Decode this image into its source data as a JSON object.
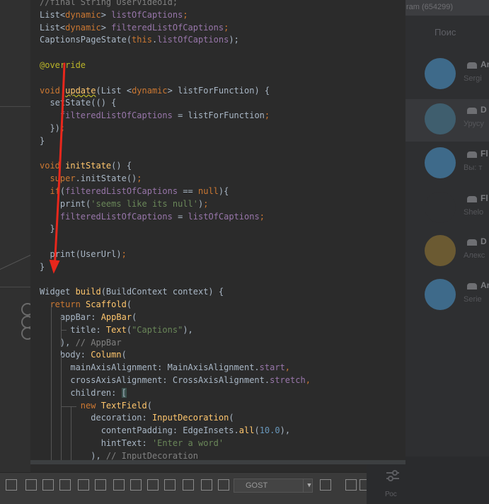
{
  "editor": {
    "lines": [
      [
        {
          "t": "//final String UserVideoId;",
          "c": "cm"
        }
      ],
      [
        {
          "t": "List<",
          "c": ""
        },
        {
          "t": "dynamic",
          "c": "kw"
        },
        {
          "t": "> ",
          "c": ""
        },
        {
          "t": "listOfCaptions",
          "c": "fld"
        },
        {
          "t": ";",
          "c": "kw"
        }
      ],
      [
        {
          "t": "List<",
          "c": ""
        },
        {
          "t": "dynamic",
          "c": "kw"
        },
        {
          "t": "> ",
          "c": ""
        },
        {
          "t": "filteredListOfCaptions",
          "c": "fld"
        },
        {
          "t": ";",
          "c": "kw"
        }
      ],
      [
        {
          "t": "CaptionsPageState(",
          "c": ""
        },
        {
          "t": "this",
          "c": "kw"
        },
        {
          "t": ".",
          "c": ""
        },
        {
          "t": "listOfCaptions",
          "c": "fld"
        },
        {
          "t": ");",
          "c": ""
        }
      ],
      [],
      [
        {
          "t": "@override",
          "c": "ann"
        }
      ],
      [],
      [
        {
          "t": "void ",
          "c": "kw"
        },
        {
          "t": "update",
          "c": "fn warn"
        },
        {
          "t": "(List <",
          "c": ""
        },
        {
          "t": "dynamic",
          "c": "kw"
        },
        {
          "t": "> listForFunction) {",
          "c": ""
        }
      ],
      [
        {
          "t": "  setState(() {",
          "c": ""
        }
      ],
      [
        {
          "t": "    ",
          "c": ""
        },
        {
          "t": "filteredListOfCaptions",
          "c": "fld"
        },
        {
          "t": " = listForFunction",
          "c": ""
        },
        {
          "t": ";",
          "c": "kw"
        }
      ],
      [
        {
          "t": "  })",
          "c": ""
        },
        {
          "t": ";",
          "c": "kw"
        }
      ],
      [
        {
          "t": "}",
          "c": ""
        }
      ],
      [],
      [
        {
          "t": "void ",
          "c": "kw"
        },
        {
          "t": "initState",
          "c": "fn"
        },
        {
          "t": "() {",
          "c": ""
        }
      ],
      [
        {
          "t": "  ",
          "c": ""
        },
        {
          "t": "super",
          "c": "kw"
        },
        {
          "t": ".initState()",
          "c": ""
        },
        {
          "t": ";",
          "c": "kw"
        }
      ],
      [
        {
          "t": "  ",
          "c": ""
        },
        {
          "t": "if",
          "c": "kw"
        },
        {
          "t": "(",
          "c": ""
        },
        {
          "t": "filteredListOfCaptions",
          "c": "fld"
        },
        {
          "t": " == ",
          "c": ""
        },
        {
          "t": "null",
          "c": "kw"
        },
        {
          "t": "){",
          "c": ""
        }
      ],
      [
        {
          "t": "    print(",
          "c": ""
        },
        {
          "t": "'seems like its null'",
          "c": "str"
        },
        {
          "t": ")",
          "c": ""
        },
        {
          "t": ";",
          "c": "kw"
        }
      ],
      [
        {
          "t": "    ",
          "c": ""
        },
        {
          "t": "filteredListOfCaptions",
          "c": "fld"
        },
        {
          "t": " = ",
          "c": ""
        },
        {
          "t": "listOfCaptions",
          "c": "fld"
        },
        {
          "t": ";",
          "c": "kw"
        }
      ],
      [
        {
          "t": "  }",
          "c": ""
        }
      ],
      [],
      [
        {
          "t": "  print(UserUrl)",
          "c": ""
        },
        {
          "t": ";",
          "c": "kw"
        }
      ],
      [
        {
          "t": "}",
          "c": ""
        }
      ],
      [],
      [
        {
          "t": "Widget ",
          "c": ""
        },
        {
          "t": "build",
          "c": "fn"
        },
        {
          "t": "(BuildContext context) {",
          "c": ""
        }
      ],
      [
        {
          "t": "  ",
          "c": ""
        },
        {
          "t": "return ",
          "c": "kw"
        },
        {
          "t": "Scaffold",
          "c": "fn"
        },
        {
          "t": "(",
          "c": ""
        }
      ],
      [
        {
          "t": "    appBar: ",
          "c": ""
        },
        {
          "t": "AppBar",
          "c": "fn"
        },
        {
          "t": "(",
          "c": ""
        }
      ],
      [
        {
          "t": "      title: ",
          "c": ""
        },
        {
          "t": "Text",
          "c": "fn"
        },
        {
          "t": "(",
          "c": ""
        },
        {
          "t": "\"Captions\"",
          "c": "str"
        },
        {
          "t": "),",
          "c": ""
        }
      ],
      [
        {
          "t": "    ), ",
          "c": ""
        },
        {
          "t": "// AppBar",
          "c": "cm"
        }
      ],
      [
        {
          "t": "    body: ",
          "c": ""
        },
        {
          "t": "Column",
          "c": "fn"
        },
        {
          "t": "(",
          "c": ""
        }
      ],
      [
        {
          "t": "      mainAxisAlignment: MainAxisAlignment.",
          "c": ""
        },
        {
          "t": "start",
          "c": "fld"
        },
        {
          "t": ",",
          "c": "kw"
        }
      ],
      [
        {
          "t": "      crossAxisAlignment: CrossAxisAlignment.",
          "c": ""
        },
        {
          "t": "stretch",
          "c": "fld"
        },
        {
          "t": ",",
          "c": "kw"
        }
      ],
      [
        {
          "t": "      children: ",
          "c": ""
        },
        {
          "t": "[",
          "c": "hl-bracket"
        }
      ],
      [
        {
          "t": "        ",
          "c": ""
        },
        {
          "t": "new ",
          "c": "kw"
        },
        {
          "t": "TextField",
          "c": "fn"
        },
        {
          "t": "(",
          "c": ""
        }
      ],
      [
        {
          "t": "          decoration: ",
          "c": ""
        },
        {
          "t": "InputDecoration",
          "c": "fn"
        },
        {
          "t": "(",
          "c": ""
        }
      ],
      [
        {
          "t": "            contentPadding: EdgeInsets.",
          "c": ""
        },
        {
          "t": "all",
          "c": "fn"
        },
        {
          "t": "(",
          "c": ""
        },
        {
          "t": "10.0",
          "c": "num"
        },
        {
          "t": "),",
          "c": ""
        }
      ],
      [
        {
          "t": "            hintText: ",
          "c": ""
        },
        {
          "t": "'Enter a word'",
          "c": "str"
        }
      ],
      [
        {
          "t": "          ), ",
          "c": ""
        },
        {
          "t": "// InputDecoration",
          "c": "cm"
        }
      ]
    ]
  },
  "telegram": {
    "header_title": "ram (654299)",
    "search_placeholder": "Поис",
    "chats": [
      {
        "name": "Ar",
        "sub": "Sergi",
        "avatar_color": "#3e6a8a",
        "selected": false,
        "icon": "group-icon"
      },
      {
        "name": "D",
        "sub": "Урусу",
        "avatar_color": "#3f5e6e",
        "selected": true,
        "icon": "group-icon"
      },
      {
        "name": "Fl",
        "sub": "Вы: т",
        "avatar_color": "#3e6a8a",
        "selected": false,
        "icon": "group-icon"
      },
      {
        "name": "Fl",
        "sub": "Shelo",
        "avatar_color": "#2e2f31",
        "selected": false,
        "icon": "group-icon"
      },
      {
        "name": "D",
        "sub": "Алекс",
        "avatar_color": "#6b5a32",
        "selected": false,
        "icon": "group-icon"
      },
      {
        "name": "Ar",
        "sub": "Serie",
        "avatar_color": "#3e6a8a",
        "selected": false,
        "icon": "megaphone-icon"
      }
    ],
    "bottom_label": "Рос"
  },
  "toolbar": {
    "select_value": "GOST"
  },
  "colors": {
    "arrow": "#e8271c"
  }
}
